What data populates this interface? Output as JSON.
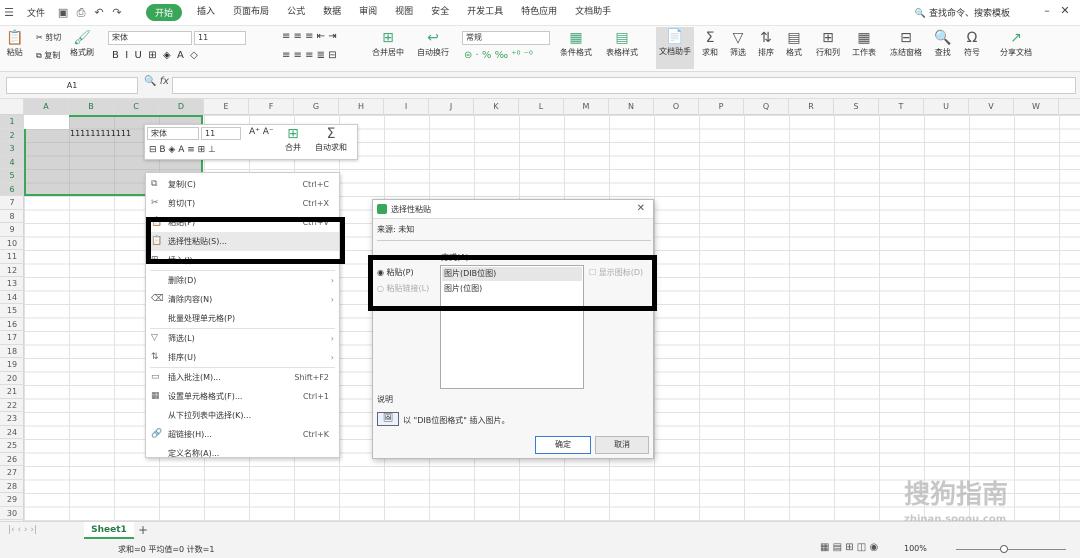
{
  "menubar": {
    "file": "文件",
    "tabs": [
      "开始",
      "插入",
      "页面布局",
      "公式",
      "数据",
      "审阅",
      "视图",
      "安全",
      "开发工具",
      "特色应用",
      "文档助手"
    ],
    "active": "开始",
    "search": "查找命令、搜索模板"
  },
  "ribbon": {
    "paste": "粘贴",
    "cut": "剪切",
    "copy": "复制",
    "format_painter": "格式刷",
    "font": "宋体",
    "size": "11",
    "merge": "合并居中",
    "wrap": "自动换行",
    "numfmt": "常规",
    "cond": "条件格式",
    "tablestyle": "表格样式",
    "docassist": "文档助手",
    "sum": "求和",
    "filter": "筛选",
    "sort": "排序",
    "format": "格式",
    "rowcol": "行和列",
    "sheet": "工作表",
    "freeze": "冻结窗格",
    "find": "查找",
    "symbol": "符号",
    "share": "分享文档"
  },
  "formula": {
    "namebox": "A1",
    "fx": "fx"
  },
  "grid": {
    "columns": [
      "A",
      "B",
      "C",
      "D",
      "E",
      "F",
      "G",
      "H",
      "I",
      "J",
      "K",
      "L",
      "M",
      "N",
      "O",
      "P",
      "Q",
      "R",
      "S",
      "T",
      "U",
      "V",
      "W"
    ],
    "rows": [
      "1",
      "2",
      "3",
      "4",
      "5",
      "6",
      "7",
      "8",
      "9",
      "10",
      "11",
      "12",
      "13",
      "14",
      "15",
      "16",
      "17",
      "18",
      "19",
      "20",
      "21",
      "22",
      "23",
      "24",
      "25",
      "26",
      "27",
      "28",
      "29",
      "30"
    ],
    "cell_b2": "111111111111"
  },
  "minitb": {
    "font": "宋体",
    "size": "11",
    "merge": "合并",
    "autosum": "自动求和"
  },
  "ctx": [
    {
      "label": "复制(C)",
      "sc": "Ctrl+C",
      "ico": "⧉"
    },
    {
      "label": "剪切(T)",
      "sc": "Ctrl+X",
      "ico": "✂"
    },
    {
      "label": "粘贴(P)",
      "sc": "Ctrl+V",
      "ico": "📋"
    },
    {
      "label": "选择性粘贴(S)...",
      "sc": "",
      "ico": "📋"
    },
    {
      "label": "插入(I)",
      "sc": "",
      "ico": "⊞",
      "arr": "›"
    },
    {
      "label": "删除(D)",
      "sc": "",
      "ico": "",
      "arr": "›"
    },
    {
      "label": "清除内容(N)",
      "sc": "",
      "ico": "⌫",
      "arr": "›"
    },
    {
      "label": "批量处理单元格(P)",
      "sc": "",
      "ico": ""
    },
    {
      "label": "筛选(L)",
      "sc": "",
      "ico": "▽",
      "arr": "›"
    },
    {
      "label": "排序(U)",
      "sc": "",
      "ico": "⇅",
      "arr": "›"
    },
    {
      "label": "插入批注(M)...",
      "sc": "Shift+F2",
      "ico": "▭"
    },
    {
      "label": "设置单元格格式(F)...",
      "sc": "Ctrl+1",
      "ico": "▦"
    },
    {
      "label": "从下拉列表中选择(K)...",
      "sc": "",
      "ico": ""
    },
    {
      "label": "超链接(H)...",
      "sc": "Ctrl+K",
      "ico": "🔗"
    },
    {
      "label": "定义名称(A)...",
      "sc": "",
      "ico": ""
    }
  ],
  "dialog": {
    "title": "选择性粘贴",
    "source": "来源: 未知",
    "as_label": "方式(A):",
    "opt_paste": "粘贴(P)",
    "opt_link": "粘贴链接(L)",
    "list": [
      "图片(DIB位图)",
      "图片(位图)"
    ],
    "show_icon": "显示图标(D)",
    "desc_label": "说明",
    "desc": "以 \"DIB位图格式\" 插入图片。",
    "ok": "确定",
    "cancel": "取消"
  },
  "status": {
    "sheet": "Sheet1",
    "stats": "求和=0  平均值=0  计数=1",
    "zoom": "100%"
  },
  "watermark": {
    "cn": "搜狗指南",
    "en": "zhinan.sogou.com"
  }
}
